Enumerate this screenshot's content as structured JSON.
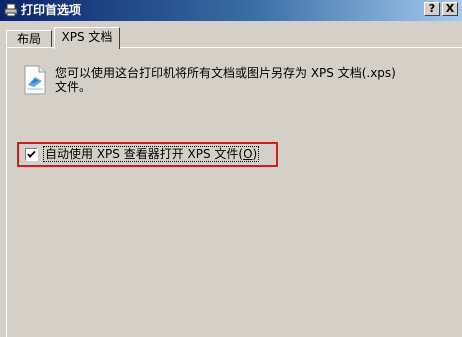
{
  "window": {
    "title": "打印首选项",
    "help_label": "?",
    "close_label": "X"
  },
  "tabs": [
    {
      "label": "布局",
      "active": false
    },
    {
      "label": "XPS 文档",
      "active": true
    }
  ],
  "content": {
    "info_line1": "您可以使用这台打印机将所有文档或图片另存为 XPS 文档(.xps)",
    "info_line2": "文件。",
    "checkbox": {
      "label_prefix": "自动使用 XPS 查看器打开 XPS 文件(",
      "accel_key": "O",
      "label_suffix": ")",
      "checked": true
    }
  },
  "colors": {
    "highlight_border": "#cc1f1f",
    "titlebar_start": "#0a246a"
  },
  "icons": {
    "title": "printer-icon",
    "document": "xps-document-icon"
  }
}
